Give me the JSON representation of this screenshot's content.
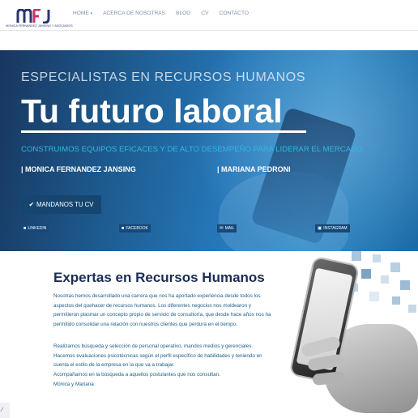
{
  "header": {
    "logo_text": "MFJ",
    "logo_subtitle": "MONICA FERNANDEZ JANSING Y ASOCIADOS",
    "nav": [
      {
        "label": "HOME",
        "has_caret": true
      },
      {
        "label": "ACERCA DE NOSOTRAS"
      },
      {
        "label": "BLOG"
      },
      {
        "label": "CV"
      },
      {
        "label": "CONTACTO"
      }
    ],
    "caret_icon": "chevron-down-icon"
  },
  "hero": {
    "subtitle": "ESPECIALISTAS EN RECURSOS HUMANOS",
    "title": "Tu futuro laboral",
    "tagline": "CONSTRUIMOS EQUIPOS EFICACES Y DE ALTO DESEMPEÑO PARA LIDERAR EL MERCADO",
    "names": [
      "| MONICA FERNANDEZ JANSING",
      "| MARIANA PEDRONI"
    ],
    "cv_button": "MANDANOS TU CV",
    "cv_icon": "check-icon",
    "social": [
      {
        "label": "LINKEDIN",
        "icon": "linkedin-icon"
      },
      {
        "label": "FACEBOOK",
        "icon": "facebook-icon"
      },
      {
        "label": "MAIL",
        "icon": "mail-icon"
      },
      {
        "label": "INSTAGRAM",
        "icon": "instagram-icon"
      }
    ],
    "colors": {
      "tagline": "#31b8e0",
      "button": "#16456f"
    }
  },
  "about": {
    "title": "Expertas en Recursos Humanos",
    "paragraph1": [
      "Nosotras hemos desarrollado una carrera que nos ha aportado experiencia desde todos los",
      "aspectos del quehacer de recursos humanos. Los diferentes negocios nos moldearon y",
      "permitieron plasmar un concepto propio de servicio de consultoría, que desde hace años nos ha",
      "permitido consolidar una relación con nuestros clientes que perdura en el tiempo."
    ],
    "paragraph2": [
      "Realizamos búsqueda y selección de personal operativo, mandos medios y gerenciales.",
      "Hacemos evaluaciones psicotécnicas según el perfil específico de habilidades y teniendo en",
      "cuenta el estilo de la empresa en la que va a trabajar.",
      "Acompañamos en la búsqueda a aquellos postulantes que nos consultan.",
      "Mónica y Mariana"
    ]
  }
}
